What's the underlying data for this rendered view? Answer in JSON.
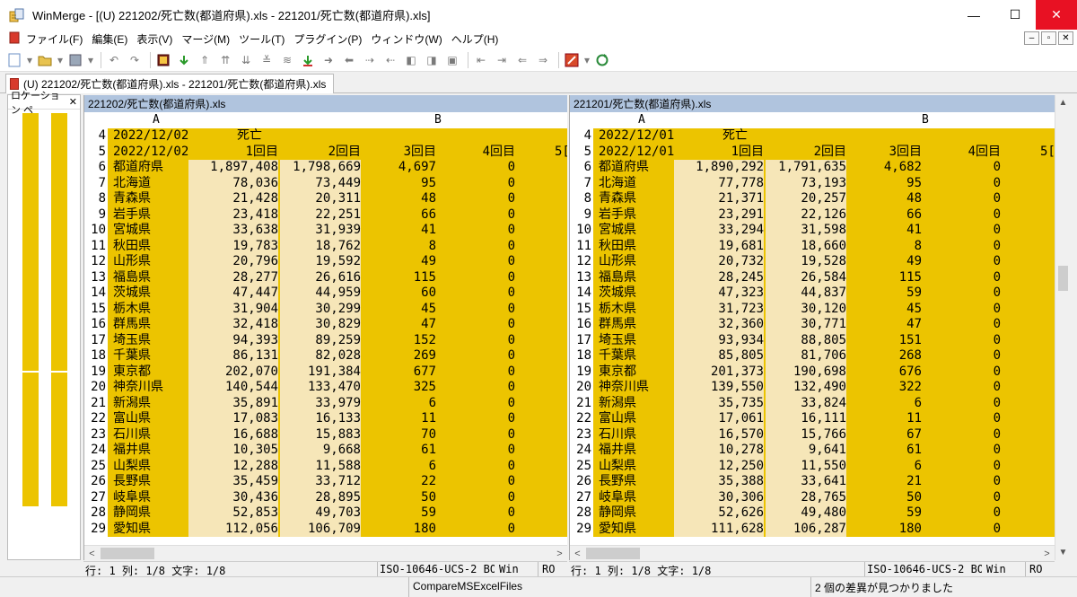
{
  "window": {
    "title": "WinMerge - [(U) 221202/死亡数(都道府県).xls - 221201/死亡数(都道府県).xls]",
    "controls": {
      "minimize": "—",
      "maximize": "☐",
      "close": "✕"
    }
  },
  "menu": {
    "items": [
      "ファイル(F)",
      "編集(E)",
      "表示(V)",
      "マージ(M)",
      "ツール(T)",
      "プラグイン(P)",
      "ウィンドウ(W)",
      "ヘルプ(H)"
    ],
    "mdi": {
      "minimize": "–",
      "restore": "▫",
      "close": "✕"
    }
  },
  "toolbar": {
    "icons": [
      "new-icon",
      "dropdown-icon",
      "open-icon",
      "dropdown-icon",
      "save-icon",
      "dropdown-icon",
      "undo-icon",
      "redo-icon",
      "options-icon",
      "next-diff-icon",
      "prev-diff-icon",
      "first-diff-icon",
      "current-diff-icon",
      "last-diff-icon",
      "copy-right-icon",
      "copy-left-icon",
      "copy-right-advance-icon",
      "copy-left-advance-icon",
      "all-right-icon",
      "all-left-icon",
      "delete-icon",
      "nav-first-icon",
      "nav-prev-icon",
      "nav-next-icon",
      "nav-last-icon",
      "tools-icon",
      "dropdown-icon",
      "refresh-icon"
    ]
  },
  "tab": {
    "label": "(U) 221202/死亡数(都道府県).xls - 221201/死亡数(都道府県).xls"
  },
  "location_pane": {
    "label": "ロケーション ペ",
    "close": "✕"
  },
  "left": {
    "file_header": "221202/死亡数(都道府県).xls",
    "col_a": "A",
    "col_b": "B",
    "rows": [
      {
        "n": "4",
        "a": "2022/12/02",
        "b": "死亡",
        "c": "",
        "d": "",
        "e": "",
        "f": ""
      },
      {
        "n": "5",
        "a": "2022/12/02",
        "b": "1回目",
        "c": "2回目",
        "d": "3回目",
        "e": "4回目",
        "f": "5["
      },
      {
        "n": "6",
        "a": "都道府県",
        "b": "1,897,408",
        "c": "1,798,669",
        "d": "4,697",
        "e": "0",
        "f": ""
      },
      {
        "n": "7",
        "a": "北海道",
        "b": "78,036",
        "c": "73,449",
        "d": "95",
        "e": "0",
        "f": ""
      },
      {
        "n": "8",
        "a": "青森県",
        "b": "21,428",
        "c": "20,311",
        "d": "48",
        "e": "0",
        "f": ""
      },
      {
        "n": "9",
        "a": "岩手県",
        "b": "23,418",
        "c": "22,251",
        "d": "66",
        "e": "0",
        "f": ""
      },
      {
        "n": "10",
        "a": "宮城県",
        "b": "33,638",
        "c": "31,939",
        "d": "41",
        "e": "0",
        "f": ""
      },
      {
        "n": "11",
        "a": "秋田県",
        "b": "19,783",
        "c": "18,762",
        "d": "8",
        "e": "0",
        "f": ""
      },
      {
        "n": "12",
        "a": "山形県",
        "b": "20,796",
        "c": "19,592",
        "d": "49",
        "e": "0",
        "f": ""
      },
      {
        "n": "13",
        "a": "福島県",
        "b": "28,277",
        "c": "26,616",
        "d": "115",
        "e": "0",
        "f": ""
      },
      {
        "n": "14",
        "a": "茨城県",
        "b": "47,447",
        "c": "44,959",
        "d": "60",
        "e": "0",
        "f": ""
      },
      {
        "n": "15",
        "a": "栃木県",
        "b": "31,904",
        "c": "30,299",
        "d": "45",
        "e": "0",
        "f": ""
      },
      {
        "n": "16",
        "a": "群馬県",
        "b": "32,418",
        "c": "30,829",
        "d": "47",
        "e": "0",
        "f": ""
      },
      {
        "n": "17",
        "a": "埼玉県",
        "b": "94,393",
        "c": "89,259",
        "d": "152",
        "e": "0",
        "f": ""
      },
      {
        "n": "18",
        "a": "千葉県",
        "b": "86,131",
        "c": "82,028",
        "d": "269",
        "e": "0",
        "f": ""
      },
      {
        "n": "19",
        "a": "東京都",
        "b": "202,070",
        "c": "191,384",
        "d": "677",
        "e": "0",
        "f": ""
      },
      {
        "n": "20",
        "a": "神奈川県",
        "b": "140,544",
        "c": "133,470",
        "d": "325",
        "e": "0",
        "f": ""
      },
      {
        "n": "21",
        "a": "新潟県",
        "b": "35,891",
        "c": "33,979",
        "d": "6",
        "e": "0",
        "f": ""
      },
      {
        "n": "22",
        "a": "富山県",
        "b": "17,083",
        "c": "16,133",
        "d": "11",
        "e": "0",
        "f": ""
      },
      {
        "n": "23",
        "a": "石川県",
        "b": "16,688",
        "c": "15,883",
        "d": "70",
        "e": "0",
        "f": ""
      },
      {
        "n": "24",
        "a": "福井県",
        "b": "10,305",
        "c": "9,668",
        "d": "61",
        "e": "0",
        "f": ""
      },
      {
        "n": "25",
        "a": "山梨県",
        "b": "12,288",
        "c": "11,588",
        "d": "6",
        "e": "0",
        "f": ""
      },
      {
        "n": "26",
        "a": "長野県",
        "b": "35,459",
        "c": "33,712",
        "d": "22",
        "e": "0",
        "f": ""
      },
      {
        "n": "27",
        "a": "岐阜県",
        "b": "30,436",
        "c": "28,895",
        "d": "50",
        "e": "0",
        "f": ""
      },
      {
        "n": "28",
        "a": "静岡県",
        "b": "52,853",
        "c": "49,703",
        "d": "59",
        "e": "0",
        "f": ""
      },
      {
        "n": "29",
        "a": "愛知県",
        "b": "112,056",
        "c": "106,709",
        "d": "180",
        "e": "0",
        "f": ""
      }
    ]
  },
  "right": {
    "file_header": "221201/死亡数(都道府県).xls",
    "col_a": "A",
    "col_b": "B",
    "rows": [
      {
        "n": "4",
        "a": "2022/12/01",
        "b": "死亡",
        "c": "",
        "d": "",
        "e": "",
        "f": ""
      },
      {
        "n": "5",
        "a": "2022/12/01",
        "b": "1回目",
        "c": "2回目",
        "d": "3回目",
        "e": "4回目",
        "f": "5["
      },
      {
        "n": "6",
        "a": "都道府県",
        "b": "1,890,292",
        "c": "1,791,635",
        "d": "4,682",
        "e": "0",
        "f": ""
      },
      {
        "n": "7",
        "a": "北海道",
        "b": "77,778",
        "c": "73,193",
        "d": "95",
        "e": "0",
        "f": ""
      },
      {
        "n": "8",
        "a": "青森県",
        "b": "21,371",
        "c": "20,257",
        "d": "48",
        "e": "0",
        "f": ""
      },
      {
        "n": "9",
        "a": "岩手県",
        "b": "23,291",
        "c": "22,126",
        "d": "66",
        "e": "0",
        "f": ""
      },
      {
        "n": "10",
        "a": "宮城県",
        "b": "33,294",
        "c": "31,598",
        "d": "41",
        "e": "0",
        "f": ""
      },
      {
        "n": "11",
        "a": "秋田県",
        "b": "19,681",
        "b2": "",
        "c": "18,660",
        "d": "8",
        "e": "0",
        "f": ""
      },
      {
        "n": "12",
        "a": "山形県",
        "b": "20,732",
        "c": "19,528",
        "d": "49",
        "e": "0",
        "f": ""
      },
      {
        "n": "13",
        "a": "福島県",
        "b": "28,245",
        "c": "26,584",
        "d": "115",
        "e": "0",
        "f": ""
      },
      {
        "n": "14",
        "a": "茨城県",
        "b": "47,323",
        "c": "44,837",
        "d": "59",
        "e": "0",
        "f": ""
      },
      {
        "n": "15",
        "a": "栃木県",
        "b": "31,723",
        "c": "30,120",
        "d": "45",
        "e": "0",
        "f": ""
      },
      {
        "n": "16",
        "a": "群馬県",
        "b": "32,360",
        "c": "30,771",
        "d": "47",
        "e": "0",
        "f": ""
      },
      {
        "n": "17",
        "a": "埼玉県",
        "b": "93,934",
        "c": "88,805",
        "d": "151",
        "e": "0",
        "f": ""
      },
      {
        "n": "18",
        "a": "千葉県",
        "b": "85,805",
        "c": "81,706",
        "d": "268",
        "e": "0",
        "f": ""
      },
      {
        "n": "19",
        "a": "東京都",
        "b": "201,373",
        "c": "190,698",
        "d": "676",
        "e": "0",
        "f": ""
      },
      {
        "n": "20",
        "a": "神奈川県",
        "b": "139,550",
        "c": "132,490",
        "d": "322",
        "e": "0",
        "f": ""
      },
      {
        "n": "21",
        "a": "新潟県",
        "b": "35,735",
        "c": "33,824",
        "d": "6",
        "e": "0",
        "f": ""
      },
      {
        "n": "22",
        "a": "富山県",
        "b": "17,061",
        "c": "16,111",
        "d": "11",
        "e": "0",
        "f": ""
      },
      {
        "n": "23",
        "a": "石川県",
        "b": "16,570",
        "c": "15,766",
        "d": "67",
        "e": "0",
        "f": ""
      },
      {
        "n": "24",
        "a": "福井県",
        "b": "10,278",
        "c": "9,641",
        "d": "61",
        "e": "0",
        "f": ""
      },
      {
        "n": "25",
        "a": "山梨県",
        "b": "12,250",
        "c": "11,550",
        "d": "6",
        "e": "0",
        "f": ""
      },
      {
        "n": "26",
        "a": "長野県",
        "b": "35,388",
        "c": "33,641",
        "d": "21",
        "e": "0",
        "f": ""
      },
      {
        "n": "27",
        "a": "岐阜県",
        "b": "30,306",
        "c": "28,765",
        "d": "50",
        "e": "0",
        "f": ""
      },
      {
        "n": "28",
        "a": "静岡県",
        "b": "52,626",
        "c": "49,480",
        "d": "59",
        "e": "0",
        "f": ""
      },
      {
        "n": "29",
        "a": "愛知県",
        "b": "111,628",
        "c": "106,287",
        "d": "180",
        "e": "0",
        "f": ""
      }
    ]
  },
  "status_left": {
    "position": "行: 1  列: 1/8  文字: 1/8",
    "encoding": "ISO-10646-UCS-2 BOM",
    "eol": "Win",
    "mode": "RO"
  },
  "status_right": {
    "position": "行: 1  列: 1/8  文字: 1/8",
    "encoding": "ISO-10646-UCS-2 BOM",
    "eol": "Win",
    "mode": "RO"
  },
  "app_status": {
    "plugin": "CompareMSExcelFiles",
    "diff_count": "2 個の差異が見つかりました"
  },
  "colors": {
    "diff": "#ecc400",
    "word_diff": "#f6e6b8",
    "header": "#b0c4de",
    "close": "#e81123"
  }
}
